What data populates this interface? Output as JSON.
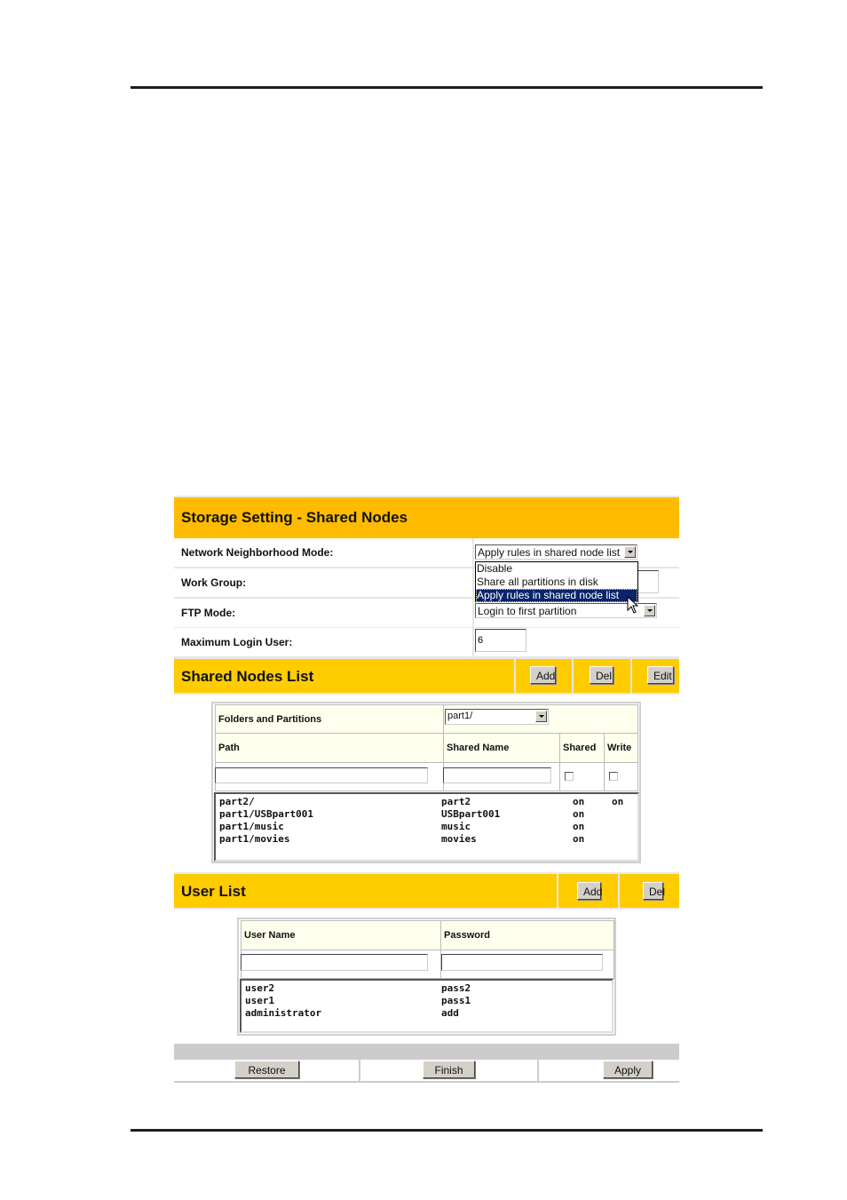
{
  "page": {
    "title": "Storage Setting - Shared Nodes"
  },
  "settings": {
    "network_neighborhood": {
      "label": "Network Neighborhood Mode:",
      "selected": "Apply rules in shared node list",
      "options": [
        "Disable",
        "Share all partitions in disk",
        "Apply rules in shared node list"
      ],
      "highlighted_option": "Apply rules in shared node list"
    },
    "work_group": {
      "label": "Work Group:",
      "value": ""
    },
    "ftp_mode": {
      "label": "FTP Mode:",
      "selected": "Login to first partition"
    },
    "max_login_user": {
      "label": "Maximum Login User:",
      "value": "6"
    }
  },
  "shared_nodes": {
    "title": "Shared Nodes List",
    "buttons": {
      "add": "Add",
      "del": "Del",
      "edit": "Edit"
    },
    "folders_label": "Folders and Partitions",
    "folders_selected": "part1/",
    "columns": {
      "path": "Path",
      "shared_name": "Shared Name",
      "shared": "Shared",
      "write": "Write"
    },
    "inputs": {
      "path": "",
      "shared_name": "",
      "shared_checked": false,
      "write_checked": false
    },
    "rows": [
      {
        "path": "part2/",
        "name": "part2",
        "shared": "on",
        "write": "on"
      },
      {
        "path": "part1/USBpart001",
        "name": "USBpart001",
        "shared": "on",
        "write": ""
      },
      {
        "path": "part1/music",
        "name": "music",
        "shared": "on",
        "write": ""
      },
      {
        "path": "part1/movies",
        "name": "movies",
        "shared": "on",
        "write": ""
      }
    ]
  },
  "user_list": {
    "title": "User List",
    "buttons": {
      "add": "Add",
      "del": "Del"
    },
    "columns": {
      "user_name": "User Name",
      "password": "Password"
    },
    "inputs": {
      "user_name": "",
      "password": ""
    },
    "rows": [
      {
        "user": "user2",
        "password": "pass2"
      },
      {
        "user": "user1",
        "password": "pass1"
      },
      {
        "user": "administrator",
        "password": "add"
      }
    ]
  },
  "footer": {
    "restore": "Restore",
    "finish": "Finish",
    "apply": "Apply"
  },
  "colors": {
    "title_bar": "#ffbb00",
    "section_bar": "#ffcc00",
    "header_cell": "#ffffee",
    "selection": "#0a246a"
  }
}
